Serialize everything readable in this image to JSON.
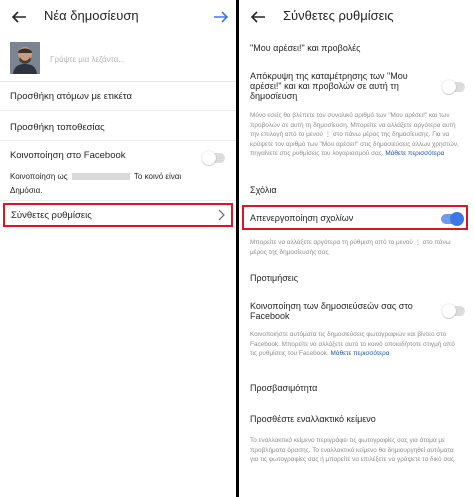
{
  "left": {
    "title": "Νέα δημοσίευση",
    "caption_placeholder": "Γράψτε μια λεζάντα...",
    "tag_people": "Προσθήκη ατόμων με ετικέτα",
    "add_location": "Προσθήκη τοποθεσίας",
    "facebook_share": {
      "label": "Κοινοποίηση στο Facebook",
      "enabled": false,
      "sub_prefix": "Κοινοποίηση ως",
      "sub_suffix": "Το κοινό είναι",
      "sub_line2": "Δημόσια."
    },
    "advanced": "Σύνθετες ρυθμίσεις"
  },
  "right": {
    "title": "Σύνθετες ρυθμίσεις",
    "likes_section": "\"Μου αρέσει!\" και προβολές",
    "hide_likes": {
      "label": "Απόκρυψη της καταμέτρησης των \"Μου αρέσει!\" και και προβολών σε αυτή τη δημοσίευση",
      "enabled": false,
      "desc": "Μόνο εσείς θα βλέπετε τον συνολικό αριθμό των \"Μου αρέσει!\" και των προβολών σε αυτή τη δημοσίευση. Μπορείτε να αλλάξετε αργότερα αυτή την επιλογή από το μενού ⋮ στο πάνω μέρος της δημοσίευσης. Για να κρύψετε τον αριθμό των \"Μου αρέσει!\" στις δημοσιεύσεις άλλων χρηστών, πηγαίνετε στις ρυθμίσεις του λογαριασμού σας.",
      "link": "Μάθετε περισσότερα"
    },
    "comments_section": "Σχόλια",
    "disable_comments": {
      "label": "Απενεργοποίηση σχολίων",
      "enabled": true,
      "desc": "Μπορείτε να αλλάξετε αργότερα τη ρύθμιση από το μενού ⋮ στο πάνω μέρος της δημοσίευσής σας."
    },
    "preferences_section": "Προτιμήσεις",
    "share_fb": {
      "label": "Κοινοποίηση των δημοσιεύσεών σας στο Facebook",
      "enabled": false,
      "desc": "Κοινοποιήστε αυτόματα τις δημοσιεύσεις φωτογραφιών και βίντεο στο Facebook. Μπορείτε να αλλάξετε αυτό το κοινό οποιαδήποτε στιγμή από τις ρυθμίσεις του Facebook.",
      "link": "Μάθετε περισσότερα"
    },
    "accessibility_section": "Προσβασιμότητα",
    "alt_text": {
      "label": "Προσθέστε εναλλακτικό κείμενο",
      "desc": "Το εναλλακτικό κείμενο περιγράφει τις φωτογραφίες σας για άτομα με προβλήματα όρασης. Το εναλλακτικό κείμενο θα δημιουργηθεί αυτόματα για τις φωτογραφίες σας ή μπορείτε να επιλέξετε να γράψετε το δικό σας."
    }
  },
  "colors": {
    "accent": "#3d77e6",
    "highlight": "#e0141e",
    "link": "#1f4f9e"
  }
}
